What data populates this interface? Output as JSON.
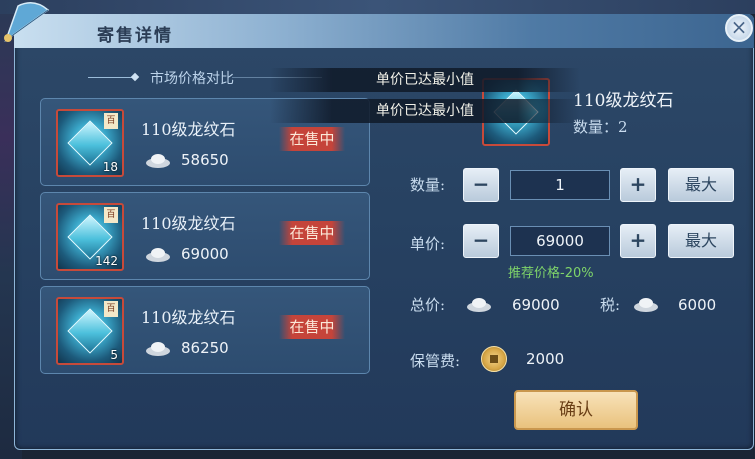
{
  "dialog": {
    "title": "寄售详情",
    "close_glyph": "×"
  },
  "market": {
    "section_title": "市场价格对比"
  },
  "toasts": [
    "单价已达最小值",
    "单价已达最小值"
  ],
  "listings": [
    {
      "name": "110级龙纹石",
      "price": "58650",
      "stack": "18",
      "status": "在售中",
      "tag": "百"
    },
    {
      "name": "110级龙纹石",
      "price": "69000",
      "stack": "142",
      "status": "在售中",
      "tag": "百"
    },
    {
      "name": "110级龙纹石",
      "price": "86250",
      "stack": "5",
      "status": "在售中",
      "tag": "百"
    }
  ],
  "selected": {
    "name": "110级龙纹石",
    "quantity_label": "数量：2"
  },
  "form": {
    "quantity_label": "数量:",
    "quantity_value": "1",
    "unit_price_label": "单价:",
    "unit_price_value": "69000",
    "minus": "−",
    "plus": "+",
    "max_label": "最大",
    "suggest": "推荐价格-20%",
    "total_label": "总价:",
    "total_value": "69000",
    "tax_label": "税:",
    "tax_value": "6000",
    "storage_label": "保管费:",
    "storage_value": "2000",
    "confirm": "确认"
  },
  "icons": {
    "currency": "silver-ingot-icon",
    "fee": "copper-coin-icon",
    "item": "dragon-stone-icon"
  }
}
